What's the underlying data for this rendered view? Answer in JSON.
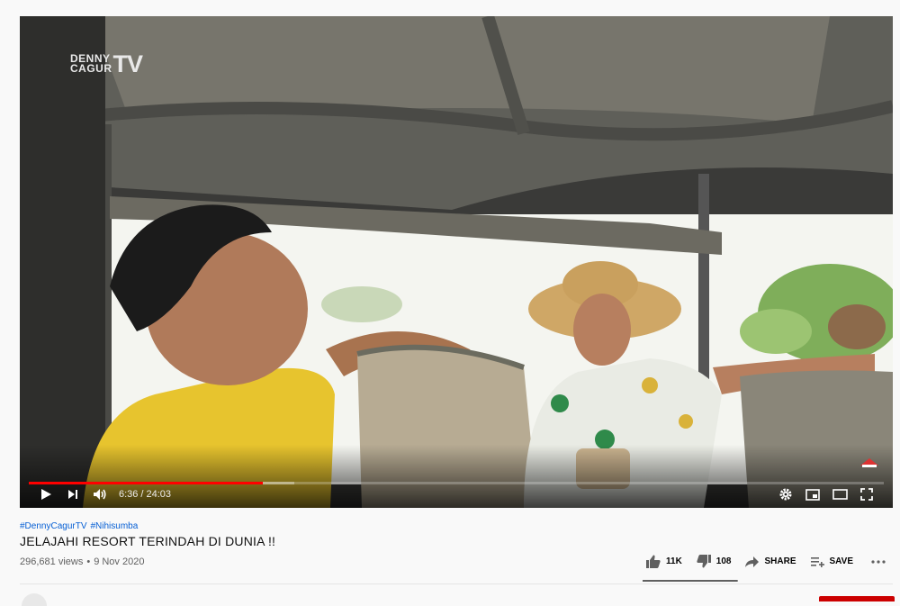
{
  "player": {
    "watermark": {
      "line1": "DENNY",
      "line2": "CAGUR",
      "line3": "TV"
    },
    "time": {
      "current": "6:36",
      "separator": "/",
      "duration": "24:03"
    },
    "progress_fraction": 0.274,
    "buffered_fraction": 0.31
  },
  "video": {
    "hashtags": [
      "#DennyCagurTV",
      "#Nihisumba"
    ],
    "title": "JELAJAHI RESORT TERINDAH DI DUNIA !!",
    "views": "296,681 views",
    "date": "9 Nov 2020"
  },
  "actions": {
    "likes": "11K",
    "dislikes": "108",
    "share": "SHARE",
    "save": "SAVE",
    "like_ratio": 0.99
  },
  "icons": [
    "play-icon",
    "next-icon",
    "volume-icon",
    "settings-icon",
    "miniplayer-icon",
    "theater-icon",
    "fullscreen-icon",
    "thumb-up-icon",
    "thumb-down-icon",
    "share-icon",
    "save-icon",
    "more-icon"
  ],
  "colors": {
    "progress": "#ff0000",
    "hashtag": "#065fd4",
    "subscribe": "#cc0000"
  }
}
